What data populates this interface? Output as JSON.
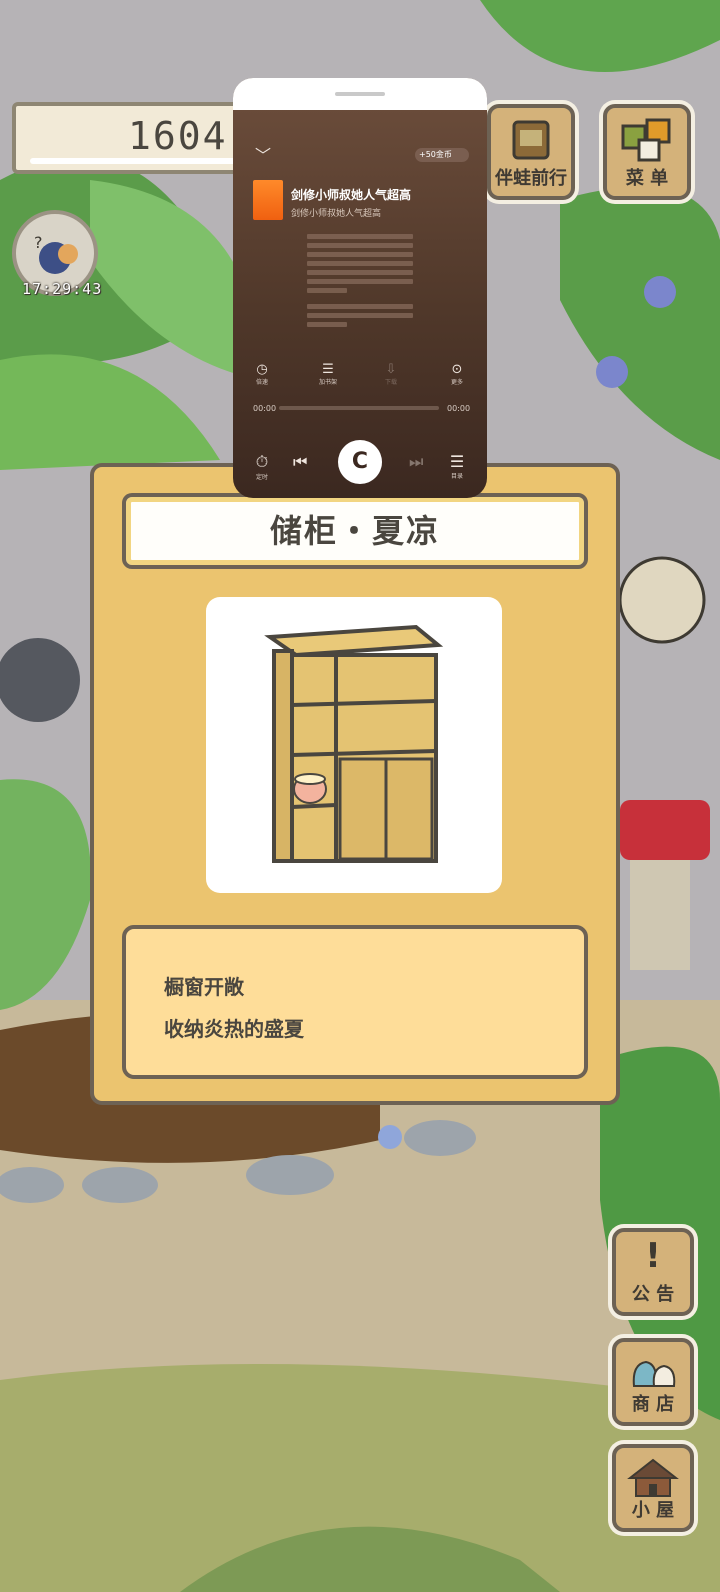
{
  "hud": {
    "clover_count": "1604",
    "clock_time": "17:29:43"
  },
  "side_buttons": {
    "travel_label": "伴蛙前行",
    "menu_label": "菜 单",
    "notice_label": "公 告",
    "shop_label": "商 店",
    "house_label": "小 屋"
  },
  "player": {
    "coin_badge": "+50金币",
    "song_title": "剑修小师叔她人气超高",
    "song_artist": "剑修小师叔她人气超高",
    "tools": [
      "倍速",
      "加书架",
      "下载",
      "更多"
    ],
    "time_current": "00:00",
    "time_total": "00:00",
    "play_glyph": "C",
    "controls": {
      "timer": "定时",
      "list": "目录"
    }
  },
  "dialog": {
    "title": "储柜・夏凉",
    "description": [
      "橱窗开敞",
      "收纳炎热的盛夏"
    ]
  },
  "colors": {
    "dialog_bg": "#ebc46f",
    "desc_bg": "#fedd99",
    "outline": "#6d6254",
    "player_bg": "#50382a"
  }
}
